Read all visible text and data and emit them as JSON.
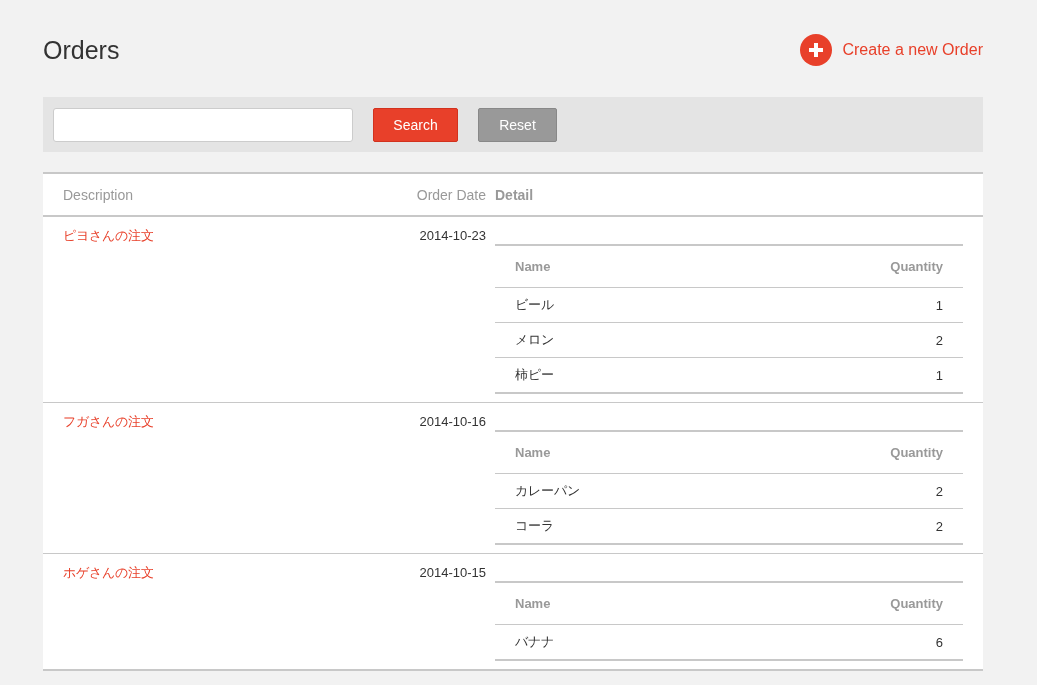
{
  "page": {
    "title": "Orders",
    "create_link": "Create a new Order"
  },
  "search": {
    "buttons": [
      "Search",
      "Reset"
    ]
  },
  "table": {
    "columns": [
      "Description",
      "Order Date",
      "Detail"
    ],
    "rows": [
      {
        "description": "ピヨさんの注文",
        "order_date": "2014-10-23",
        "detail": {
          "columns": [
            "Name",
            "Quantity"
          ],
          "items": [
            {
              "name": "ビール",
              "quantity": "1"
            },
            {
              "name": "メロン",
              "quantity": "2"
            },
            {
              "name": "柿ピー",
              "quantity": "1"
            }
          ]
        }
      },
      {
        "description": "フガさんの注文",
        "order_date": "2014-10-16",
        "detail": {
          "columns": [
            "Name",
            "Quantity"
          ],
          "items": [
            {
              "name": "カレーパン",
              "quantity": "2"
            },
            {
              "name": "コーラ",
              "quantity": "2"
            }
          ]
        }
      },
      {
        "description": "ホゲさんの注文",
        "order_date": "2014-10-15",
        "detail": {
          "columns": [
            "Name",
            "Quantity"
          ],
          "items": [
            {
              "name": "バナナ",
              "quantity": "6"
            }
          ]
        }
      }
    ]
  }
}
